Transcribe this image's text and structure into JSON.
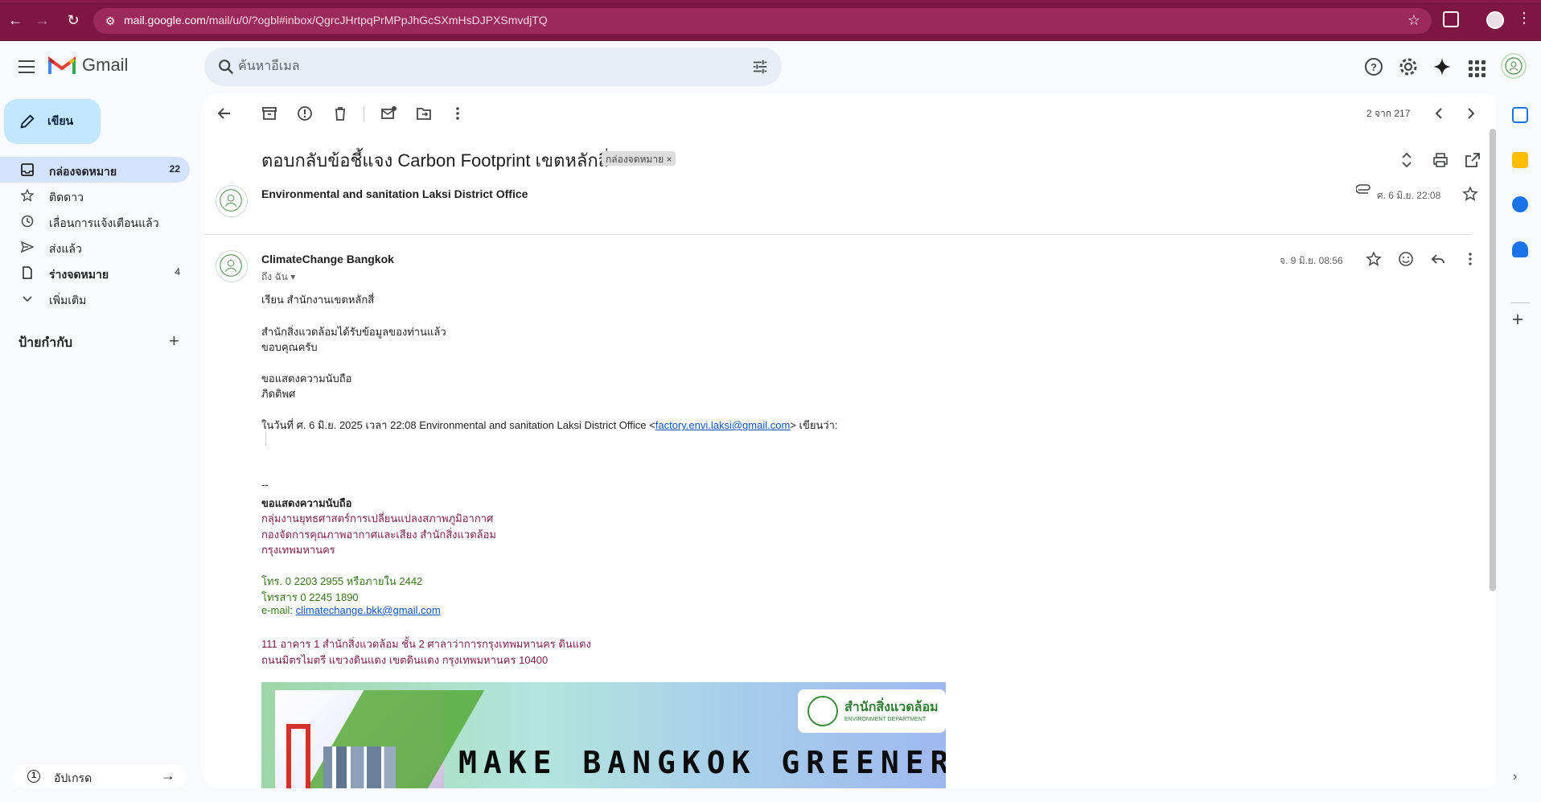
{
  "browser": {
    "url_host": "mail.google.com",
    "url_path": "/mail/u/0/?ogbl#inbox/QgrcJHrtpqPrMPpJhGcSXmHsDJPXSmvdjTQ"
  },
  "app": {
    "name": "Gmail",
    "search_placeholder": "ค้นหาอีเมล"
  },
  "sidebar": {
    "compose_label": "เขียน",
    "items": [
      {
        "label": "กล่องจดหมาย",
        "count": "22",
        "icon": "inbox-icon",
        "active": true
      },
      {
        "label": "ติดดาว",
        "count": "",
        "icon": "star-icon",
        "active": false
      },
      {
        "label": "เลื่อนการแจ้งเตือนแล้ว",
        "count": "",
        "icon": "clock-icon",
        "active": false
      },
      {
        "label": "ส่งแล้ว",
        "count": "",
        "icon": "send-icon",
        "active": false
      },
      {
        "label": "ร่างจดหมาย",
        "count": "4",
        "icon": "draft-icon",
        "active": false
      },
      {
        "label": "เพิ่มเติม",
        "count": "",
        "icon": "chevron-down-icon",
        "active": false
      }
    ],
    "labels_title": "ป้ายกำกับ",
    "upgrade_label": "อัปเกรด"
  },
  "toolbar": {
    "pager": "2 จาก 217"
  },
  "thread": {
    "subject": "ตอบกลับข้อชี้แจง Carbon Footprint เขตหลักสี่",
    "label_chip": "กล่องจดหมาย",
    "collapsed": {
      "sender": "Environmental and sanitation Laksi District Office",
      "date": "ศ. 6 มิ.ย. 22:08"
    },
    "open": {
      "sender": "ClimateChange Bangkok",
      "to": "ถึง ฉัน",
      "date": "จ. 9 มิ.ย. 08:56",
      "body": {
        "greeting": "เรียน สำนักงานเขตหลักสี่",
        "line1": "สำนักสิ่งแวดล้อมได้รับข้อมูลของท่านแล้ว",
        "line2": "ขอบคุณครับ",
        "closing1": "ขอแสดงความนับถือ",
        "closing2": "ภิดติพศ",
        "quote_prefix": "ในวันที่ ศ. 6 มิ.ย. 2025 เวลา 22:08 Environmental and sanitation Laksi District Office <",
        "quote_email": "factory.envi.laksi@gmail.com",
        "quote_suffix": "> เขียนว่า:"
      },
      "signature": {
        "dashes": "--",
        "regards": "ขอแสดงความนับถือ",
        "org1": "กลุ่มงานยุทธศาสตร์การเปลี่ยนแปลงสภาพภูมิอากาศ",
        "org2": "กองจัดการคุณภาพอากาศและเสียง สำนักสิ่งแวดล้อม",
        "org3": "กรุงเทพมหานคร",
        "tel": "โทร. 0 2203 2955 หรือภายใน 2442",
        "fax": "โทรสาร 0 2245 1890",
        "email_label": "e-mail: ",
        "email": "climatechange.bkk@gmail.com",
        "addr1": "111 อาคาร 1 สำนักสิ่งแวดล้อม ชั้น 2 ศาลาว่าการกรุงเทพมหานคร ดินแดง",
        "addr2": "ถนนมิตรไมตรี แขวงดินแดง เขตดินแดง กรุงเทพมหานคร 10400"
      },
      "banner": {
        "logo_th": "สำนักสิ่งแวดล้อม",
        "logo_en": "ENVIRONMENT DEPARTMENT",
        "slogan": "MAKE BANGKOK GREENER!"
      }
    }
  },
  "colors": {
    "chrome": "#7d1640",
    "compose_bg": "#c2e7ff",
    "active_nav": "#d3e3fd"
  }
}
